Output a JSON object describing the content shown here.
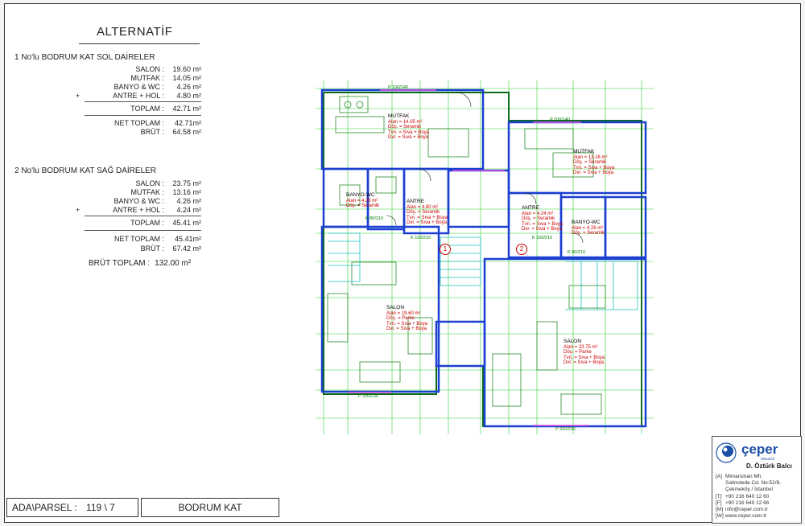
{
  "title": "ALTERNATİF",
  "apartments": [
    {
      "heading": "1  No'lu BODRUM KAT SOL DAİRELER",
      "rooms": [
        {
          "label": "SALON :",
          "value": "19.60 m²"
        },
        {
          "label": "MUTFAK :",
          "value": "14.05 m²"
        },
        {
          "label": "BANYO & WC :",
          "value": "4.26 m²"
        },
        {
          "label": "ANTRE + HOL :",
          "value": "4.80 m²",
          "prefix": "+"
        }
      ],
      "toplam": {
        "label": "TOPLAM :",
        "value": "42.71 m²"
      },
      "net": {
        "label": "NET TOPLAM :",
        "value": "42.71m²"
      },
      "brut": {
        "label": "BRÜT :",
        "value": "64.58 m²"
      }
    },
    {
      "heading": "2  No'lu BODRUM KAT SAĞ DAİRELER",
      "rooms": [
        {
          "label": "SALON :",
          "value": "23.75 m²"
        },
        {
          "label": "MUTFAK :",
          "value": "13.16 m²"
        },
        {
          "label": "BANYO & WC :",
          "value": "4.26 m²"
        },
        {
          "label": "ANTRE + HOL :",
          "value": "4.24 m²",
          "prefix": "+"
        }
      ],
      "toplam": {
        "label": "TOPLAM :",
        "value": "45.41 m²"
      },
      "net": {
        "label": "NET TOPLAM :",
        "value": "45.41m²"
      },
      "brut": {
        "label": "BRÜT :",
        "value": "67.42 m²"
      }
    }
  ],
  "grand_total": {
    "label": "BRÜT TOPLAM :",
    "value": "132.00 m²"
  },
  "plan": {
    "rooms_left": [
      {
        "name": "MUTFAK",
        "lines": [
          "Alan = 14.05 m²",
          "Döş. = Seramik",
          "Tvn. = Sıva + Boya",
          "Dvr. = Sıva + Boya"
        ]
      },
      {
        "name": "BANYO-WC",
        "lines": [
          "Alan = 4.26 m²",
          "Döş. = Seramik"
        ]
      },
      {
        "name": "ANTRE",
        "lines": [
          "Alan = 4.80 m²",
          "Döş. = Seramik",
          "Tvn. = Sıva + Boya",
          "Dvr. = Sıva + Boya"
        ]
      },
      {
        "name": "SALON",
        "lines": [
          "Alan = 19.60 m²",
          "Döş. = Parke",
          "Tvn. = Sıva + Boya",
          "Dvr. = Sıva + Boya"
        ]
      }
    ],
    "rooms_right": [
      {
        "name": "MUTFAK",
        "lines": [
          "Alan = 13.16 m²",
          "Döş. = Seramik",
          "Tvn. = Sıva + Boya",
          "Dvr. = Sıva + Boya"
        ]
      },
      {
        "name": "ANTRE",
        "lines": [
          "Alan = 4.24 m²",
          "Döş. = Seramik",
          "Tvn. = Sıva + Boya",
          "Dvr. = Sıva + Boya"
        ]
      },
      {
        "name": "BANYO-WC",
        "lines": [
          "Alan = 4.26 m²",
          "Döş. = Seramik"
        ]
      },
      {
        "name": "SALON",
        "lines": [
          "Alan = 23.75 m²",
          "Döş. = Parke",
          "Tvn. = Sıva + Boya",
          "Dvr. = Sıva + Boya"
        ]
      }
    ],
    "unit_markers": [
      "1",
      "2"
    ],
    "window_tags": [
      "P 100/140",
      "P 100/140",
      "P 200/230",
      "P 200/230"
    ],
    "door_tags": [
      "K 100/210",
      "K 100/210",
      "K 80/210",
      "K 80/210"
    ],
    "colors": {
      "wall": "#1a3fd1",
      "grid": "#2fd12f",
      "furniture": "#2a8a2a",
      "stairs": "#18c0c0",
      "label": "#cc0000",
      "dimension": "#008000"
    }
  },
  "footer": {
    "ada_label": "ADA\\PARSEL :",
    "ada_value": "119 \\ 7",
    "floor": "BODRUM KAT"
  },
  "company": {
    "brand": "çeper",
    "sub": "Mimarlık",
    "person": "D. Öztürk Balcı",
    "contacts": [
      {
        "k": "[A]",
        "v": "Mimarsinan Mh."
      },
      {
        "k": "",
        "v": "Salimdede Cd. No:52/8."
      },
      {
        "k": "",
        "v": "Çekmeköy / İstanbul"
      },
      {
        "k": "[T]",
        "v": "+90 216 640 12 60"
      },
      {
        "k": "[F]",
        "v": "+90 216 640 12 66"
      },
      {
        "k": "[M]",
        "v": "info@ceper.com.tr"
      },
      {
        "k": "[W]",
        "v": "www.ceper.com.tr"
      }
    ]
  }
}
